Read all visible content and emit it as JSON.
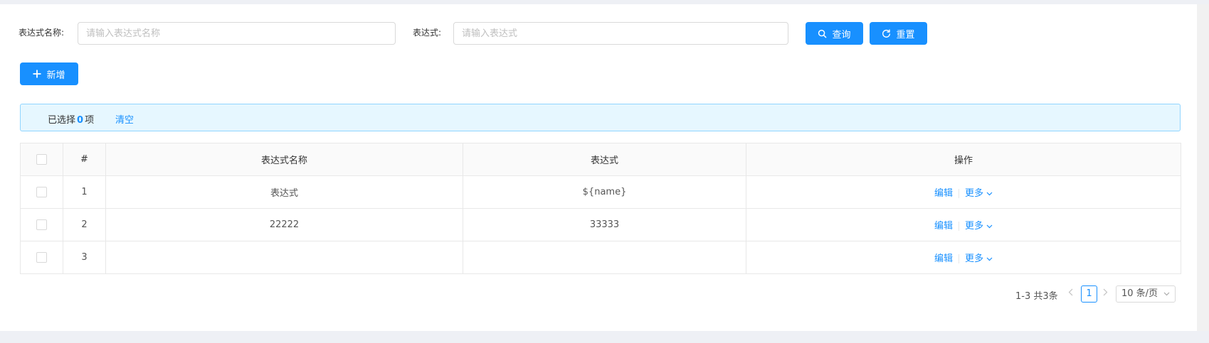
{
  "search": {
    "name_label": "表达式名称:",
    "name_placeholder": "请输入表达式名称",
    "expr_label": "表达式:",
    "expr_placeholder": "请输入表达式",
    "query_label": "查询",
    "reset_label": "重置"
  },
  "toolbar": {
    "add_label": "新增"
  },
  "alert": {
    "selected_prefix": "已选择",
    "selected_count": "0",
    "selected_suffix": "项",
    "clear_label": "清空"
  },
  "table": {
    "headers": [
      "#",
      "表达式名称",
      "表达式",
      "操作"
    ],
    "rows": [
      {
        "index": "1",
        "name": "表达式",
        "expression": "${name}"
      },
      {
        "index": "2",
        "name": "22222",
        "expression": "33333"
      },
      {
        "index": "3",
        "name": "",
        "expression": ""
      }
    ],
    "actions": {
      "edit": "编辑",
      "more": "更多"
    }
  },
  "pagination": {
    "total_text": "1-3 共3条",
    "current_page": "1",
    "page_size_label": "10 条/页"
  },
  "colors": {
    "primary": "#1890ff",
    "alert_bg": "#e6f7ff",
    "alert_border": "#91d5ff"
  }
}
